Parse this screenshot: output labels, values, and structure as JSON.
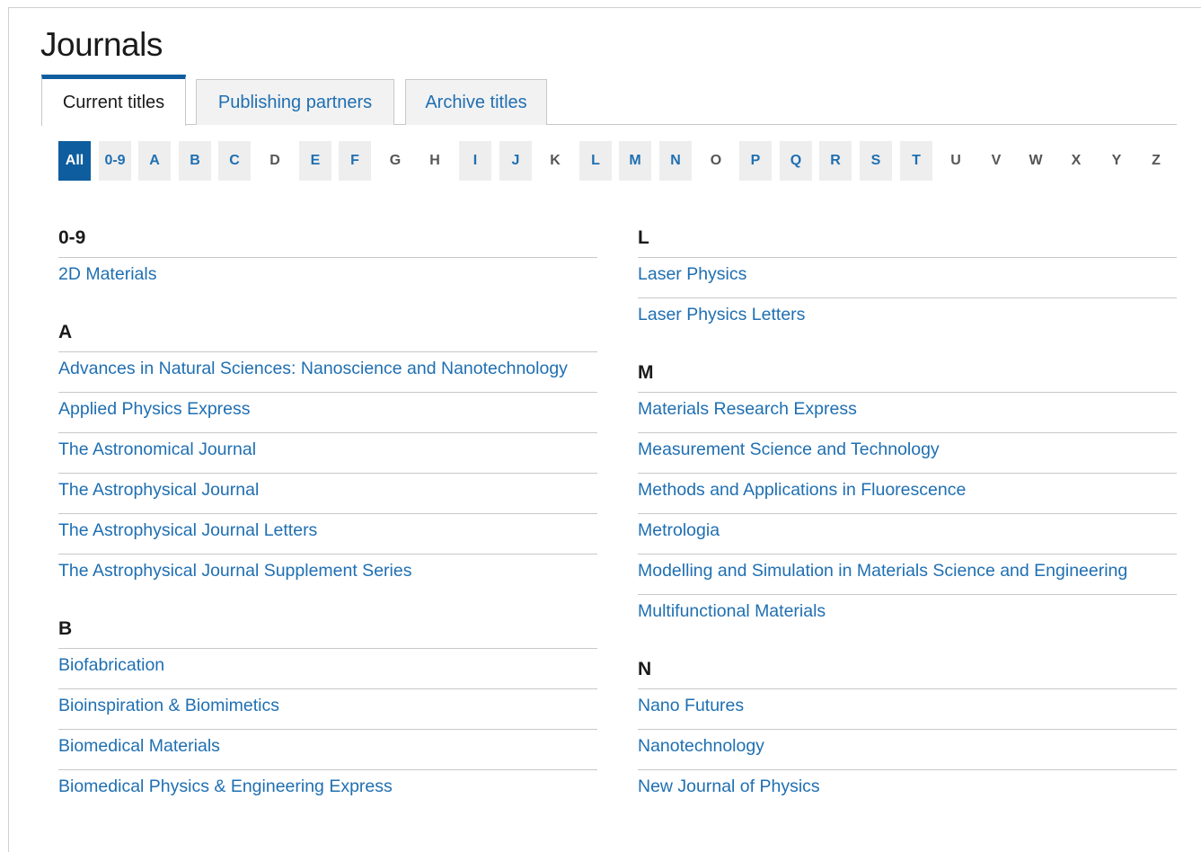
{
  "page": {
    "title": "Journals"
  },
  "tabs": [
    {
      "label": "Current titles",
      "active": true
    },
    {
      "label": "Publishing partners",
      "active": false
    },
    {
      "label": "Archive titles",
      "active": false
    }
  ],
  "alphabet": [
    {
      "label": "All",
      "state": "selected"
    },
    {
      "label": "0-9",
      "state": "has"
    },
    {
      "label": "A",
      "state": "has"
    },
    {
      "label": "B",
      "state": "has"
    },
    {
      "label": "C",
      "state": "has"
    },
    {
      "label": "D",
      "state": "none"
    },
    {
      "label": "E",
      "state": "has"
    },
    {
      "label": "F",
      "state": "has"
    },
    {
      "label": "G",
      "state": "none"
    },
    {
      "label": "H",
      "state": "none"
    },
    {
      "label": "I",
      "state": "has"
    },
    {
      "label": "J",
      "state": "has"
    },
    {
      "label": "K",
      "state": "none"
    },
    {
      "label": "L",
      "state": "has"
    },
    {
      "label": "M",
      "state": "has"
    },
    {
      "label": "N",
      "state": "has"
    },
    {
      "label": "O",
      "state": "none"
    },
    {
      "label": "P",
      "state": "has"
    },
    {
      "label": "Q",
      "state": "has"
    },
    {
      "label": "R",
      "state": "has"
    },
    {
      "label": "S",
      "state": "has"
    },
    {
      "label": "T",
      "state": "has"
    },
    {
      "label": "U",
      "state": "none"
    },
    {
      "label": "V",
      "state": "none"
    },
    {
      "label": "W",
      "state": "none"
    },
    {
      "label": "X",
      "state": "none"
    },
    {
      "label": "Y",
      "state": "none"
    },
    {
      "label": "Z",
      "state": "none"
    }
  ],
  "columns": {
    "left": [
      {
        "heading": "0-9",
        "journals": [
          "2D Materials"
        ]
      },
      {
        "heading": "A",
        "journals": [
          "Advances in Natural Sciences: Nanoscience and Nanotechnology",
          "Applied Physics Express",
          "The Astronomical Journal",
          "The Astrophysical Journal",
          "The Astrophysical Journal Letters",
          "The Astrophysical Journal Supplement Series"
        ]
      },
      {
        "heading": "B",
        "journals": [
          "Biofabrication",
          "Bioinspiration & Biomimetics",
          "Biomedical Materials",
          "Biomedical Physics & Engineering Express"
        ]
      }
    ],
    "right": [
      {
        "heading": "L",
        "journals": [
          "Laser Physics",
          "Laser Physics Letters"
        ]
      },
      {
        "heading": "M",
        "journals": [
          "Materials Research Express",
          "Measurement Science and Technology",
          "Methods and Applications in Fluorescence",
          "Metrologia",
          "Modelling and Simulation in Materials Science and Engineering",
          "Multifunctional Materials"
        ]
      },
      {
        "heading": "N",
        "journals": [
          "Nano Futures",
          "Nanotechnology",
          "New Journal of Physics"
        ]
      }
    ]
  },
  "colors": {
    "link": "#1f6fb2",
    "selected": "#0e5d9e",
    "divider": "#c8c8c8"
  }
}
